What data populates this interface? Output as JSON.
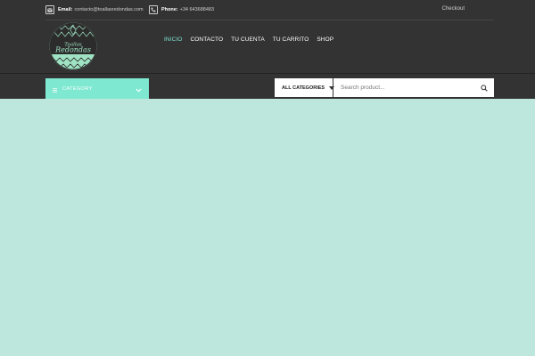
{
  "topbar": {
    "email_label": "Email:",
    "email_value": "contacto@toallasredondas.com",
    "phone_label": "Phone:",
    "phone_value": "+34 643688483",
    "checkout": "Checkout"
  },
  "logo": {
    "line1": "Toallas",
    "line2": "Redondas"
  },
  "nav": {
    "items": [
      "INICIO",
      "CONTACTO",
      "TU CUENTA",
      "TU CARRITO",
      "SHOP"
    ]
  },
  "category": {
    "label": "CATEGORY"
  },
  "search": {
    "category_select": "ALL CATEGORIES",
    "placeholder": "Search product..."
  },
  "colors": {
    "header_bg": "#333333",
    "accent": "#7fe8d0",
    "page_bg": "#bde6dc"
  }
}
